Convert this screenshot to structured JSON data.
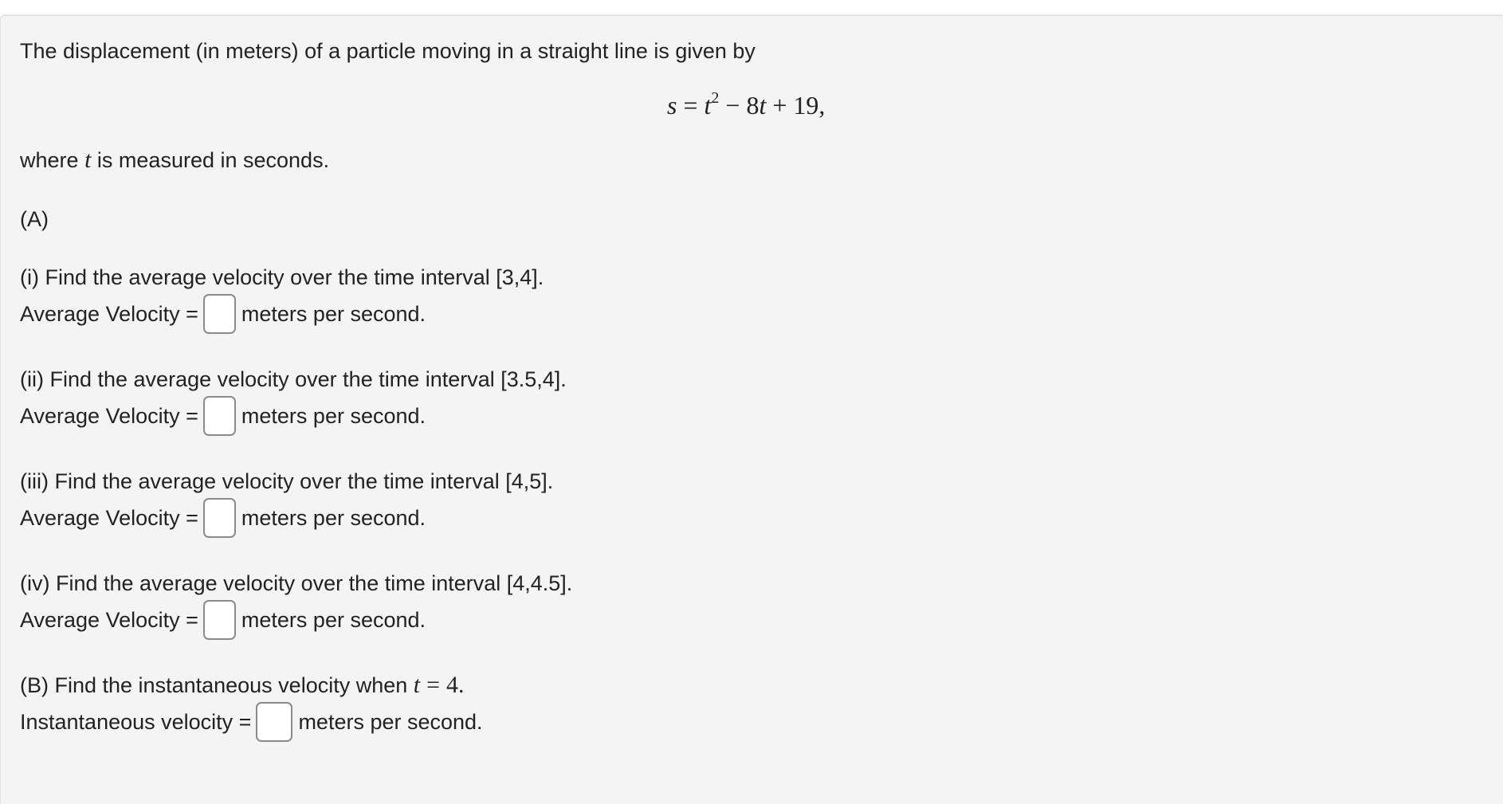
{
  "problem": {
    "intro": "The displacement (in meters) of a particle moving in a straight line is given by",
    "equation": {
      "lhs": "s",
      "equals": "=",
      "t": "t",
      "exponent": "2",
      "minus": "−",
      "term2": "8t",
      "plus": "+",
      "constant": "19,"
    },
    "where_prefix": "where",
    "where_var": "t",
    "where_suffix": "is measured in seconds.",
    "part_a_label": "(A)"
  },
  "questions": [
    {
      "prompt": "(i) Find the average velocity over the time interval [3,4].",
      "answer_label": "Average Velocity =",
      "answer_value": "",
      "units": "meters per second."
    },
    {
      "prompt": "(ii) Find the average velocity over the time interval [3.5,4].",
      "answer_label": "Average Velocity =",
      "answer_value": "",
      "units": "meters per second."
    },
    {
      "prompt": "(iii) Find the average velocity over the time interval [4,5].",
      "answer_label": "Average Velocity =",
      "answer_value": "",
      "units": "meters per second."
    },
    {
      "prompt": "(iv) Find the average velocity over the time interval [4,4.5].",
      "answer_label": "Average Velocity =",
      "answer_value": "",
      "units": "meters per second."
    }
  ],
  "part_b": {
    "prompt_prefix": "(B) Find the instantaneous velocity when",
    "var": "t",
    "equals": "=",
    "value": "4.",
    "answer_label": "Instantaneous velocity =",
    "answer_value": "",
    "units": "meters per second."
  }
}
